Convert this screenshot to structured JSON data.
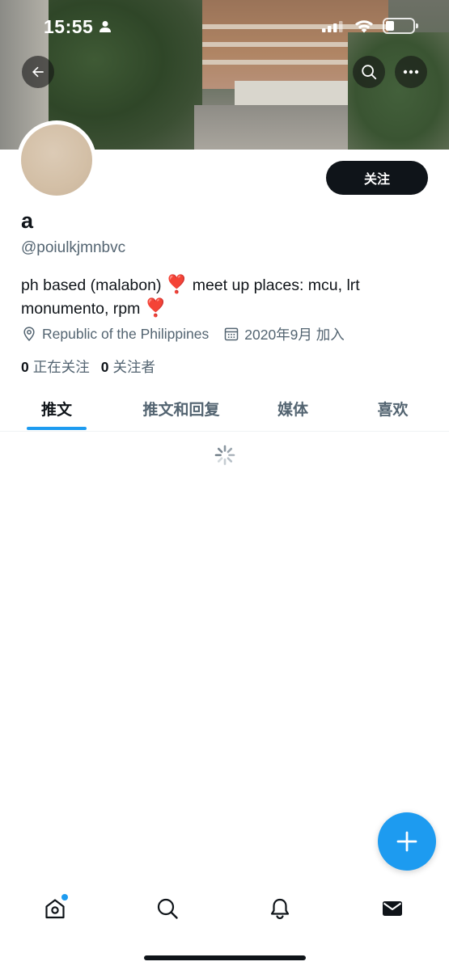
{
  "status_bar": {
    "time": "15:55"
  },
  "profile": {
    "follow_label": "关注",
    "display_name": "a",
    "handle": "@poiulkjmnbvc",
    "bio_part1": "ph based (malabon) ",
    "bio_heart": "❣️",
    "bio_part2": " meet up places: mcu, lrt monumento, rpm ",
    "location": "Republic of the Philippines",
    "joined": "2020年9月 加入",
    "following_count": "0",
    "following_label": "正在关注",
    "followers_count": "0",
    "followers_label": "关注者"
  },
  "tabs": [
    {
      "label": "推文",
      "active": true
    },
    {
      "label": "推文和回复",
      "active": false
    },
    {
      "label": "媒体",
      "active": false
    },
    {
      "label": "喜欢",
      "active": false
    }
  ],
  "icons": {
    "back": "arrow-left-icon",
    "search": "search-icon",
    "more": "more-icon",
    "location": "location-pin-icon",
    "calendar": "calendar-icon",
    "spinner": "loading-spinner-icon",
    "compose": "plus-icon",
    "nav_home": "home-icon",
    "nav_search": "search-icon",
    "nav_notifications": "bell-icon",
    "nav_messages": "envelope-icon"
  },
  "colors": {
    "accent": "#1d9bf0",
    "text": "#0f1419",
    "secondary_text": "#536471",
    "follow_button": "#0f1419",
    "heart": "#e0245e"
  }
}
